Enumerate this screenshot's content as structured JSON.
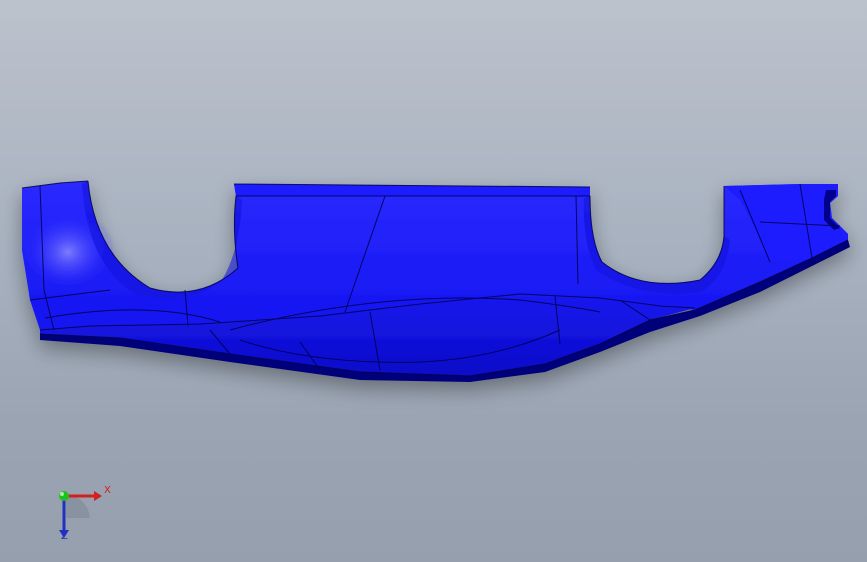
{
  "viewport": {
    "background_top": "#bcc2cc",
    "background_bottom": "#959fae"
  },
  "model": {
    "color": "#1a1aff",
    "shade_color": "#0000a0",
    "edge_color": "#00004a"
  },
  "triad": {
    "x_label": "X",
    "z_label": "Z",
    "x_color": "#d22020",
    "y_color": "#20c020",
    "z_color": "#2030c0"
  }
}
